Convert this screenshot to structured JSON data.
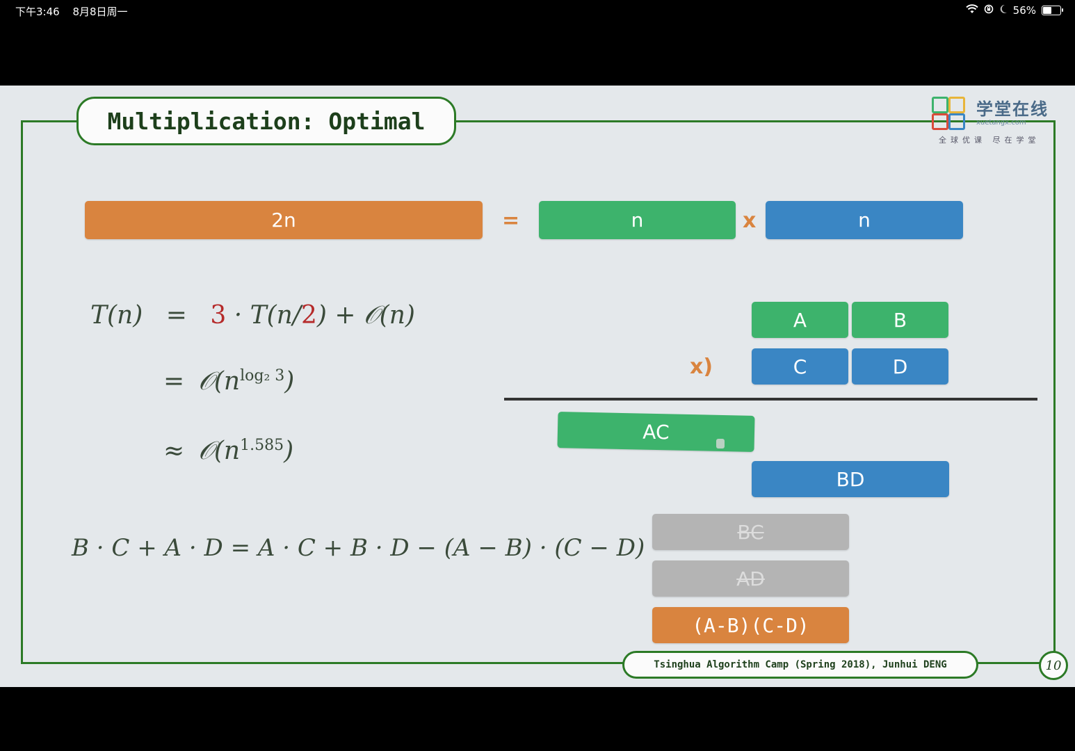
{
  "status_bar": {
    "time": "下午3:46",
    "date": "8月8日周一",
    "battery": "56%",
    "battery_level": 0.56,
    "icons": [
      "wifi-icon",
      "rotation-lock-icon",
      "moon-icon",
      "battery-icon"
    ]
  },
  "slide": {
    "title": "Multiplication: Optimal",
    "logo": {
      "name": "学堂在线",
      "url_text": "xuetangx.com",
      "slogan": "全球优课 尽在学堂"
    },
    "top_row": {
      "total": "2n",
      "equals": "=",
      "left": "n",
      "times": "x",
      "right": "n"
    },
    "grid": {
      "a": "A",
      "b": "B",
      "c": "C",
      "d": "D",
      "times_label": "x)"
    },
    "products": {
      "ac": "AC",
      "bd": "BD",
      "bc": "BC",
      "ad": "AD",
      "diff": "(A-B)(C-D)"
    },
    "equations": {
      "line1_lhs": "T(n)",
      "line1_eq": "=",
      "line1_coef": "3",
      "line1_mid": "· T(n/",
      "line1_two": "2",
      "line1_tail": ") + 𝒪(n)",
      "line2_eq": "=",
      "line2_base": "𝒪(n",
      "line2_exp": "log₂ 3",
      "line2_close": ")",
      "line3_eq": "≈",
      "line3_base": "𝒪(n",
      "line3_exp": "1.585",
      "line3_close": ")",
      "identity": "B · C + A · D  =  A · C + B · D − (A − B) · (C − D)"
    },
    "footer": "Tsinghua Algorithm Camp (Spring 2018), Junhui DENG",
    "page_number": "10"
  },
  "colors": {
    "frame_green": "#2c7a26",
    "orange": "#d9843f",
    "green": "#3db36c",
    "blue": "#3a86c4",
    "gray": "#b4b4b4",
    "red": "#b52a2a"
  }
}
